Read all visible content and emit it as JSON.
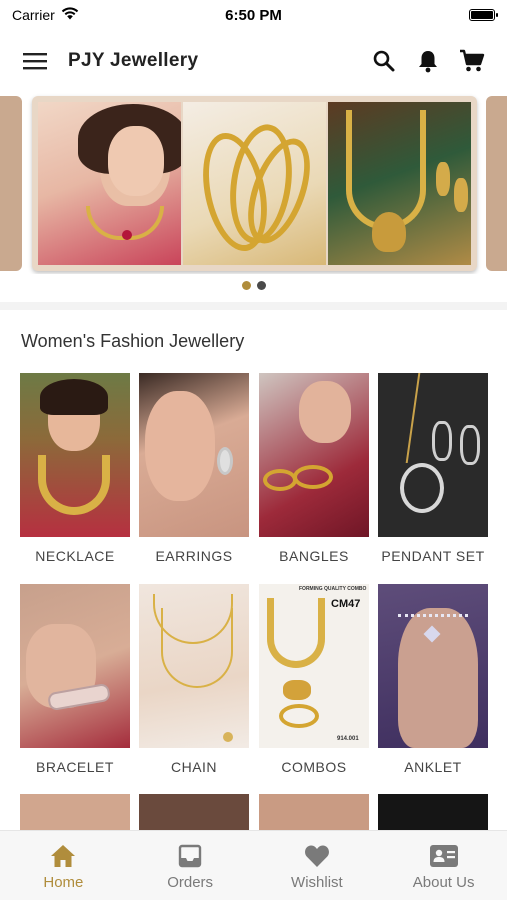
{
  "status_bar": {
    "carrier": "Carrier",
    "time": "6:50 PM",
    "battery_level": 1.0
  },
  "app_bar": {
    "title": "PJY Jewellery",
    "menu_icon": "hamburger-menu-icon",
    "actions": [
      {
        "name": "search",
        "icon": "search-icon"
      },
      {
        "name": "notifications",
        "icon": "bell-icon"
      },
      {
        "name": "cart",
        "icon": "shopping-cart-icon"
      }
    ]
  },
  "carousel": {
    "slide_count": 2,
    "active_index": 0
  },
  "section": {
    "title": "Women's Fashion Jewellery"
  },
  "categories": [
    {
      "label": "NECKLACE"
    },
    {
      "label": "EARRINGS"
    },
    {
      "label": "BANGLES"
    },
    {
      "label": "PENDANT SET"
    },
    {
      "label": "BRACELET"
    },
    {
      "label": "CHAIN"
    },
    {
      "label": "COMBOS"
    },
    {
      "label": "ANKLET"
    }
  ],
  "combo_image_text": {
    "header": "FORMING QUALITY COMBO",
    "code": "CM47",
    "price": "914.001"
  },
  "bottom_nav": {
    "items": [
      {
        "label": "Home",
        "icon": "home-icon",
        "active": true
      },
      {
        "label": "Orders",
        "icon": "inbox-icon",
        "active": false
      },
      {
        "label": "Wishlist",
        "icon": "heart-icon",
        "active": false
      },
      {
        "label": "About Us",
        "icon": "contact-card-icon",
        "active": false
      }
    ]
  },
  "colors": {
    "accent": "#b08d3c",
    "inactive": "#7a7a7a",
    "text": "#222222"
  }
}
